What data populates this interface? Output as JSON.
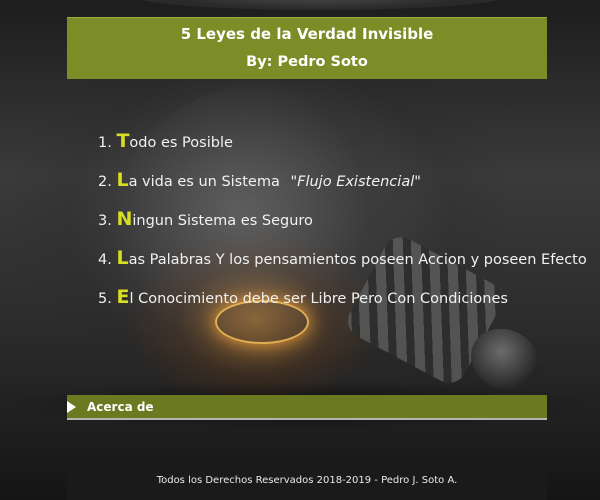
{
  "header": {
    "title": "5 Leyes de la Verdad Invisible",
    "byline": "By: Pedro Soto"
  },
  "laws": [
    {
      "number": "1.",
      "initial": "T",
      "rest": "odo es Posible",
      "quote": ""
    },
    {
      "number": "2.",
      "initial": "L",
      "rest": "a vida es un Sistema",
      "quote": "\"Flujo Existencial\""
    },
    {
      "number": "3.",
      "initial": "N",
      "rest": "ingun Sistema es Seguro",
      "quote": ""
    },
    {
      "number": "4.",
      "initial": "L",
      "rest": "as Palabras Y los pensamientos poseen Accion y poseen Efecto",
      "quote": ""
    },
    {
      "number": "5.",
      "initial": "E",
      "rest": "l Conocimiento debe ser Libre Pero Con Condiciones",
      "quote": ""
    }
  ],
  "about": {
    "label": "Acerca de",
    "icon": "play-triangle-icon"
  },
  "footer": {
    "text": "Todos los Derechos Reservados 2018-2019 - Pedro J. Soto A."
  },
  "colors": {
    "header_bg": "#7c8c26",
    "about_bg": "#6b7a20",
    "initial_accent": "#d7df20",
    "footer_bg": "#1a1a1a"
  }
}
